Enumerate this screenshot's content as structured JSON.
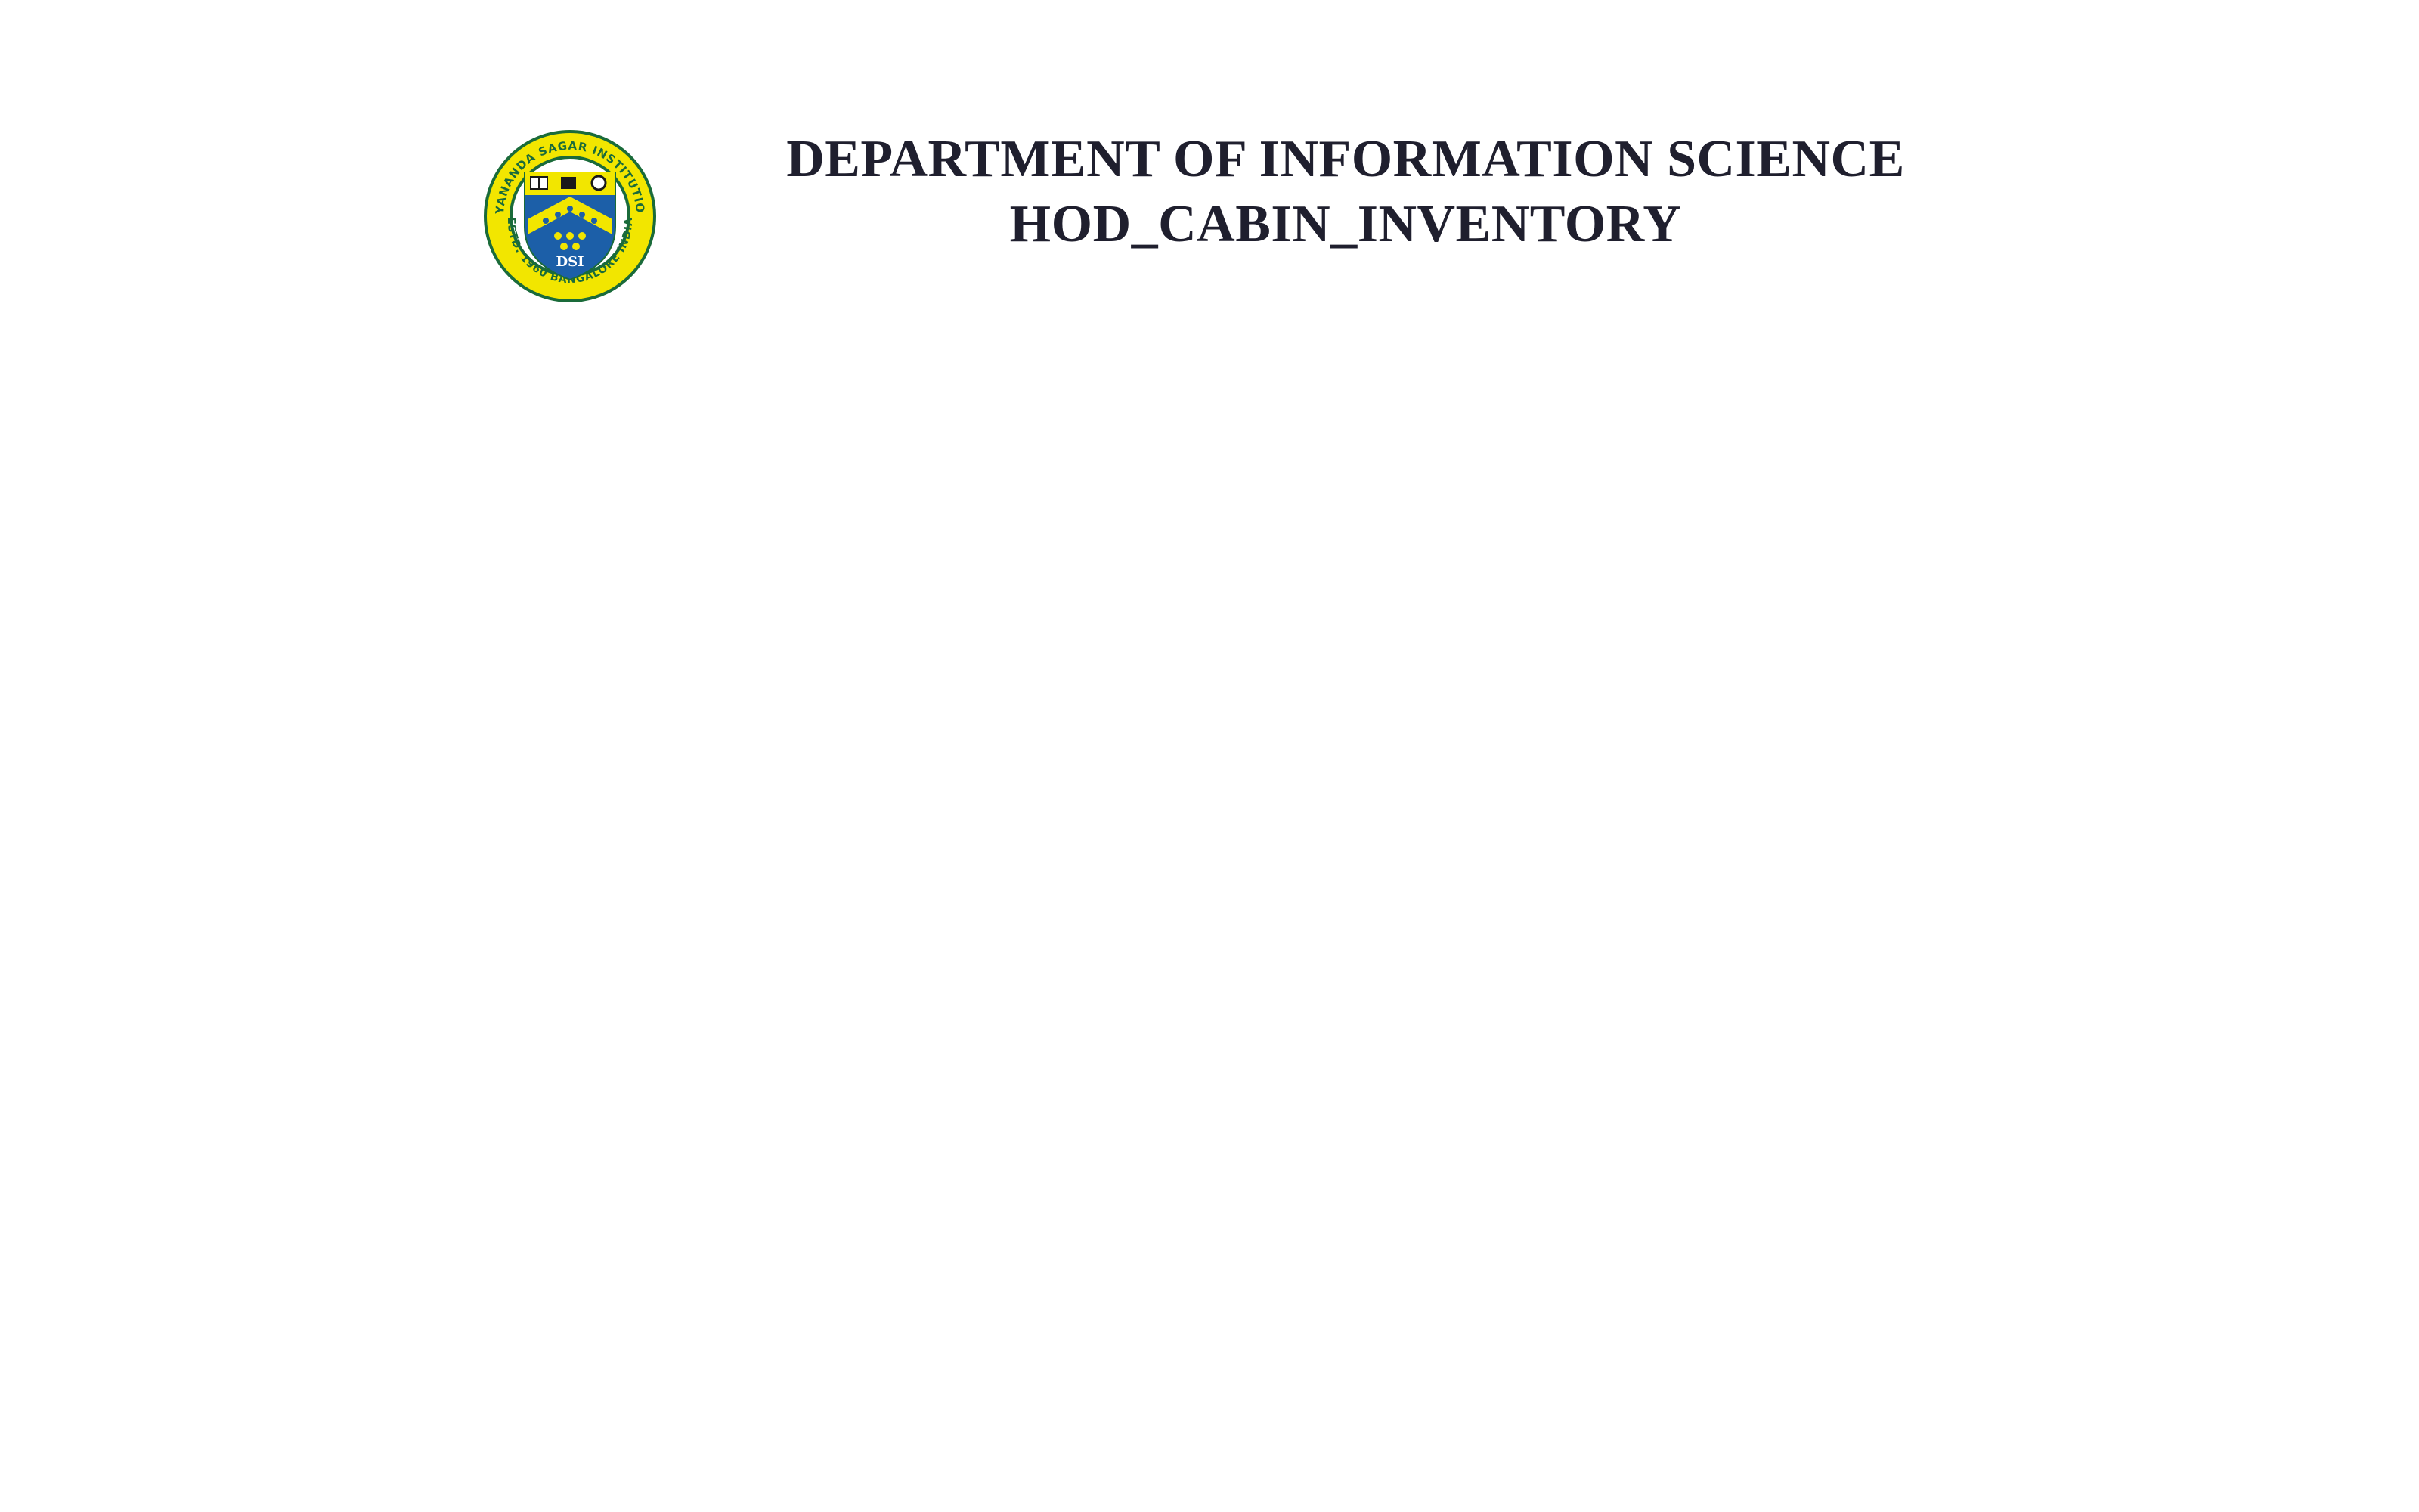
{
  "header": {
    "department": "DEPARTMENT OF INFORMATION SCIENCE",
    "subtitle": "HOD_CABIN_INVENTORY"
  },
  "logo": {
    "icon": "institution-crest-icon",
    "ring_text_top": "DAYANANDA SAGAR INSTITUTIONS",
    "ring_text_bottom": "ESTD. 1960 BANGALORE INDIA",
    "shield_text": "DSI",
    "colors": {
      "ring": "#f2e600",
      "ring_outline": "#1a6b3a",
      "shield_blue": "#1c5fa8",
      "chevron_yellow": "#f2e600"
    }
  }
}
